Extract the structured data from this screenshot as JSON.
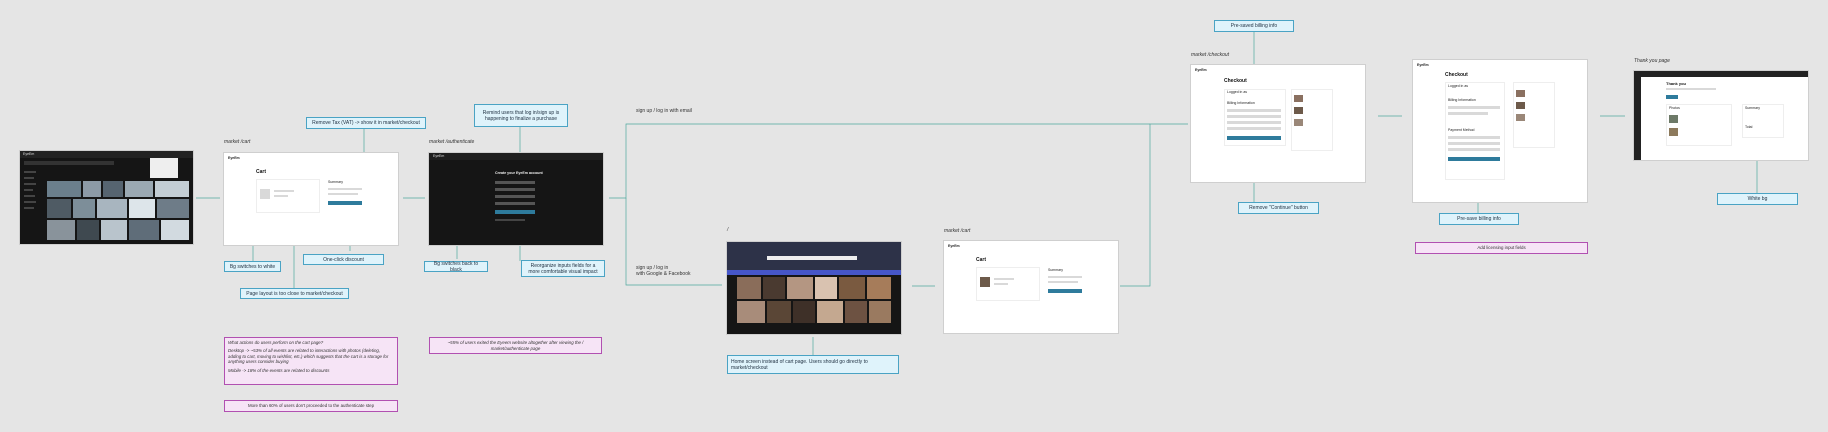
{
  "pages": {
    "cart_market": "market /cart",
    "authenticate": "market /authenticate",
    "checkout": "market /checkout",
    "home": "/",
    "cart_home": "market /cart",
    "thank_you": "Thank you page"
  },
  "flows": {
    "email": "sign up / log in with email",
    "social": "sign up / log in\nwith Google & Facebook"
  },
  "notes": {
    "remove_tax": "Remove Tax (VAT) -> show it in market/checkout",
    "remind_users": "Remind users that log in/sign up is happening to finalize a purchase",
    "prepaid_billing": "Pre-saved billing info",
    "bg_white": "Bg switches to white",
    "one_click": "One-click discount",
    "page_layout": "Page layout is too close to market/checkout",
    "bg_black": "Bg switches back to black",
    "reorganize": "Reorganize inputs fields for a more comfortable visual impact",
    "remove_continue": "Remove \"Continue\" button",
    "presave_billing": "Pre-save billing info",
    "white_bg": "White bg",
    "home_instead": "Home screen instead of cart page. Users should go directly to market/checkout",
    "add_licensing": "Add licensing input fields"
  },
  "findings": {
    "actions_q": "What actions do users perform on the cart page?",
    "desktop": "Desktop -> ~53% of all events are related to interactions with photos (deleting, adding to cart, moving to wishlist, etc.) which suggests that the cart is a storage for anything users consider buying",
    "mobile": "Mobile -> 18% of the events are related to discounts",
    "quit": "~55% of users exited the Eyeem website altogether after viewing the / market/authenticate page",
    "sixty": "More than 60% of users don't proceeded to the authenticate step"
  },
  "mock": {
    "brand": "EyeEm",
    "cart_title": "Cart",
    "summary": "Summary",
    "checkout_title": "Checkout",
    "create_account": "Create your EyeEm account",
    "thank_you": "Thank you",
    "logged_in": "Logged in as",
    "billing": "Billing Information",
    "payment": "Payment Method",
    "photos_title": "Photos",
    "total": "Total"
  },
  "colors": {
    "accent": "#2e7b9c",
    "note_blue_bg": "#dff3fb",
    "note_blue_border": "#4aa3c4",
    "note_purple_bg": "#f6e4f6",
    "note_purple_border": "#b150b1",
    "wire": "#4fa89e"
  }
}
